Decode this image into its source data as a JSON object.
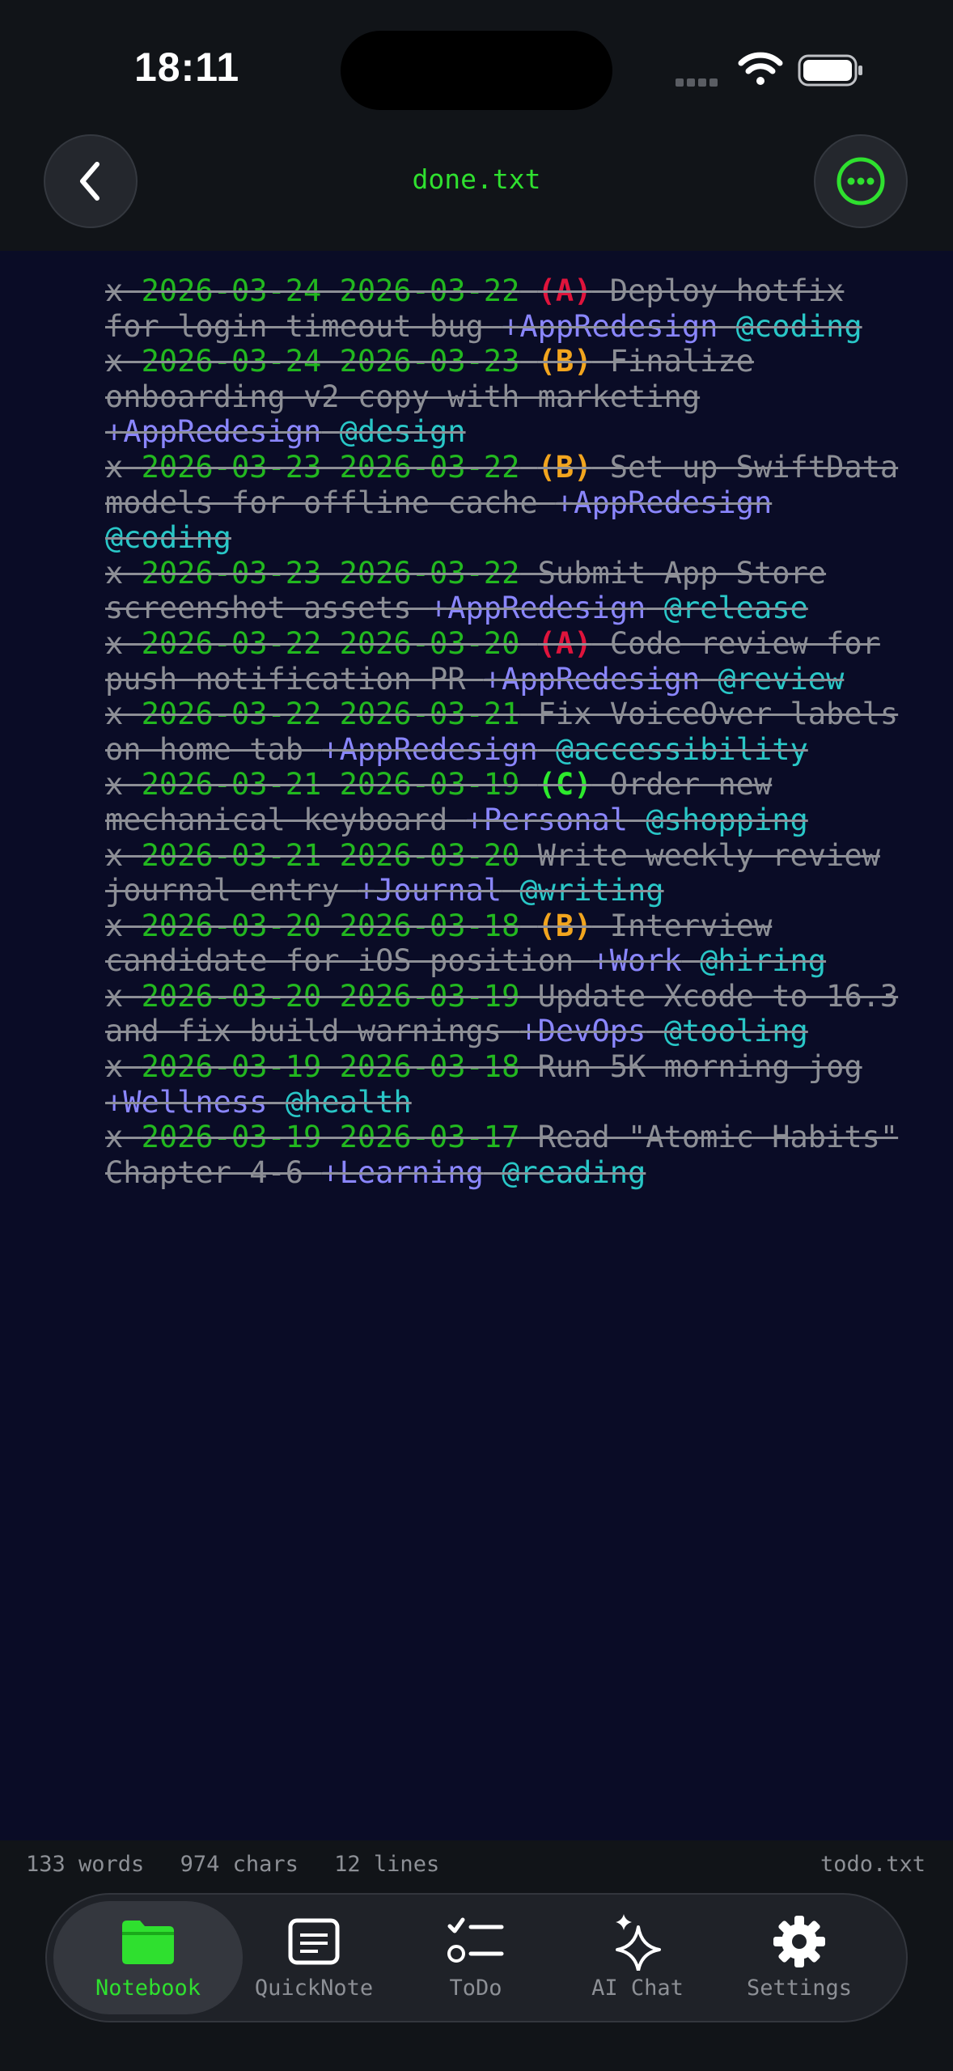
{
  "status": {
    "time": "18:11"
  },
  "header": {
    "title": "done.txt"
  },
  "todos": [
    {
      "segments": [
        {
          "t": "x ",
          "c": "plain"
        },
        {
          "t": "2026-03-24 2026-03-22",
          "c": "date"
        },
        {
          "t": " ",
          "c": "plain"
        },
        {
          "t": "(A)",
          "c": "pri-a"
        },
        {
          "t": " Deploy hotfix for login timeout bug ",
          "c": "plain"
        },
        {
          "t": "+AppRedesign",
          "c": "proj"
        },
        {
          "t": " ",
          "c": "plain"
        },
        {
          "t": "@coding",
          "c": "ctx"
        }
      ]
    },
    {
      "segments": [
        {
          "t": "x ",
          "c": "plain"
        },
        {
          "t": "2026-03-24 2026-03-23",
          "c": "date"
        },
        {
          "t": " ",
          "c": "plain"
        },
        {
          "t": "(B)",
          "c": "pri-b"
        },
        {
          "t": " Finalize onboarding v2 copy with marketing ",
          "c": "plain"
        },
        {
          "t": "+AppRedesign",
          "c": "proj"
        },
        {
          "t": " ",
          "c": "plain"
        },
        {
          "t": "@design",
          "c": "ctx"
        }
      ]
    },
    {
      "segments": [
        {
          "t": "x ",
          "c": "plain"
        },
        {
          "t": "2026-03-23 2026-03-22",
          "c": "date"
        },
        {
          "t": " ",
          "c": "plain"
        },
        {
          "t": "(B)",
          "c": "pri-b"
        },
        {
          "t": " Set up SwiftData models for offline cache ",
          "c": "plain"
        },
        {
          "t": "+AppRedesign",
          "c": "proj"
        },
        {
          "t": " ",
          "c": "plain"
        },
        {
          "t": "@coding",
          "c": "ctx"
        }
      ]
    },
    {
      "segments": [
        {
          "t": "x ",
          "c": "plain"
        },
        {
          "t": "2026-03-23 2026-03-22",
          "c": "date"
        },
        {
          "t": " Submit App Store screenshot assets ",
          "c": "plain"
        },
        {
          "t": "+AppRedesign",
          "c": "proj"
        },
        {
          "t": " ",
          "c": "plain"
        },
        {
          "t": "@release",
          "c": "ctx"
        }
      ]
    },
    {
      "segments": [
        {
          "t": "x ",
          "c": "plain"
        },
        {
          "t": "2026-03-22 2026-03-20",
          "c": "date"
        },
        {
          "t": " ",
          "c": "plain"
        },
        {
          "t": "(A)",
          "c": "pri-a"
        },
        {
          "t": " Code review for push notification PR ",
          "c": "plain"
        },
        {
          "t": "+AppRedesign",
          "c": "proj"
        },
        {
          "t": " ",
          "c": "plain"
        },
        {
          "t": "@review",
          "c": "ctx"
        }
      ]
    },
    {
      "segments": [
        {
          "t": "x ",
          "c": "plain"
        },
        {
          "t": "2026-03-22 2026-03-21",
          "c": "date"
        },
        {
          "t": " Fix VoiceOver labels on home tab ",
          "c": "plain"
        },
        {
          "t": "+AppRedesign",
          "c": "proj"
        },
        {
          "t": " ",
          "c": "plain"
        },
        {
          "t": "@accessibility",
          "c": "ctx"
        }
      ]
    },
    {
      "segments": [
        {
          "t": "x ",
          "c": "plain"
        },
        {
          "t": "2026-03-21 2026-03-19",
          "c": "date"
        },
        {
          "t": " ",
          "c": "plain"
        },
        {
          "t": "(C)",
          "c": "pri-c"
        },
        {
          "t": " Order new mechanical keyboard ",
          "c": "plain"
        },
        {
          "t": "+Personal",
          "c": "proj"
        },
        {
          "t": " ",
          "c": "plain"
        },
        {
          "t": "@shopping",
          "c": "ctx"
        }
      ]
    },
    {
      "segments": [
        {
          "t": "x ",
          "c": "plain"
        },
        {
          "t": "2026-03-21 2026-03-20",
          "c": "date"
        },
        {
          "t": " Write weekly review journal entry ",
          "c": "plain"
        },
        {
          "t": "+Journal",
          "c": "proj"
        },
        {
          "t": " ",
          "c": "plain"
        },
        {
          "t": "@writing",
          "c": "ctx"
        }
      ]
    },
    {
      "segments": [
        {
          "t": "x ",
          "c": "plain"
        },
        {
          "t": "2026-03-20 2026-03-18",
          "c": "date"
        },
        {
          "t": " ",
          "c": "plain"
        },
        {
          "t": "(B)",
          "c": "pri-b"
        },
        {
          "t": " Interview candidate for iOS position ",
          "c": "plain"
        },
        {
          "t": "+Work",
          "c": "proj"
        },
        {
          "t": " ",
          "c": "plain"
        },
        {
          "t": "@hiring",
          "c": "ctx"
        }
      ]
    },
    {
      "segments": [
        {
          "t": "x ",
          "c": "plain"
        },
        {
          "t": "2026-03-20 2026-03-19",
          "c": "date"
        },
        {
          "t": " Update Xcode to 16.3 and fix build warnings ",
          "c": "plain"
        },
        {
          "t": "+DevOps",
          "c": "proj"
        },
        {
          "t": " ",
          "c": "plain"
        },
        {
          "t": "@tooling",
          "c": "ctx"
        }
      ]
    },
    {
      "segments": [
        {
          "t": "x ",
          "c": "plain"
        },
        {
          "t": "2026-03-19 2026-03-18",
          "c": "date"
        },
        {
          "t": " Run 5K morning jog ",
          "c": "plain"
        },
        {
          "t": "+Wellness",
          "c": "proj"
        },
        {
          "t": " ",
          "c": "plain"
        },
        {
          "t": "@health",
          "c": "ctx"
        }
      ]
    },
    {
      "segments": [
        {
          "t": "x ",
          "c": "plain"
        },
        {
          "t": "2026-03-19 2026-03-17",
          "c": "date"
        },
        {
          "t": " Read \"Atomic Habits\" Chapter 4-6 ",
          "c": "plain"
        },
        {
          "t": "+Learning",
          "c": "proj"
        },
        {
          "t": " ",
          "c": "plain"
        },
        {
          "t": "@reading",
          "c": "ctx"
        }
      ]
    }
  ],
  "info": {
    "words": "133 words",
    "chars": "974 chars",
    "lines": "12 lines",
    "file": "todo.txt"
  },
  "tabs": [
    {
      "label": "Notebook",
      "icon": "folder-icon",
      "active": true
    },
    {
      "label": "QuickNote",
      "icon": "note-icon",
      "active": false
    },
    {
      "label": "ToDo",
      "icon": "checklist-icon",
      "active": false
    },
    {
      "label": "AI Chat",
      "icon": "sparkles-icon",
      "active": false
    },
    {
      "label": "Settings",
      "icon": "gear-icon",
      "active": false
    }
  ],
  "colors": {
    "accent": "#2fe02f",
    "date": "#22b81f",
    "priority_a": "#e0143c",
    "priority_b": "#f2a51e",
    "priority_c": "#2dea2d",
    "project": "#8a86ff",
    "context": "#29c7c7"
  }
}
